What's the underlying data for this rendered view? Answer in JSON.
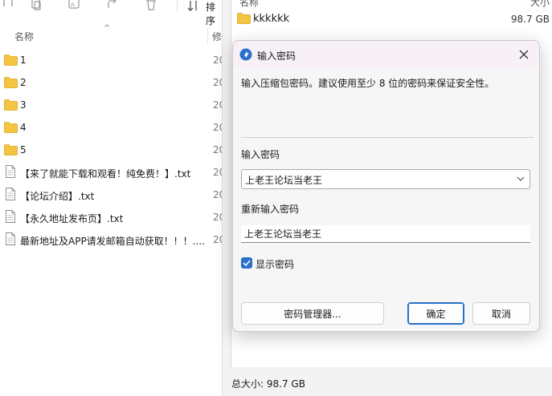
{
  "explorer": {
    "toolbar": {
      "sort_label": "排序"
    },
    "columns": {
      "name": "名称",
      "modified": "修"
    },
    "files": [
      {
        "name": "1",
        "type": "folder",
        "date": "20"
      },
      {
        "name": "2",
        "type": "folder",
        "date": "20"
      },
      {
        "name": "3",
        "type": "folder",
        "date": "20"
      },
      {
        "name": "4",
        "type": "folder",
        "date": "20"
      },
      {
        "name": "5",
        "type": "folder",
        "date": "20"
      },
      {
        "name": "【来了就能下载和观看！纯免费！】.txt",
        "type": "file",
        "date": "20"
      },
      {
        "name": "【论坛介绍】.txt",
        "type": "file",
        "date": "20"
      },
      {
        "name": "【永久地址发布页】.txt",
        "type": "file",
        "date": "20"
      },
      {
        "name": "最新地址及APP请发邮箱自动获取！！！....",
        "type": "file",
        "date": "20"
      }
    ]
  },
  "archive": {
    "header_name": "名称",
    "header_size": "大小",
    "folder_name": "kkkkkk",
    "folder_size": "98.7 GB",
    "status": "总大小: 98.7 GB"
  },
  "dialog": {
    "title": "输入密码",
    "description": "输入压缩包密码。建议使用至少 8 位的密码来保证安全性。",
    "password_label": "输入密码",
    "password_value": "上老王论坛当老王",
    "reenter_label": "重新输入密码",
    "reenter_value": "上老王论坛当老王",
    "show_password_label": "显示密码",
    "show_password_checked": true,
    "manager_button": "密码管理器...",
    "ok_button": "确定",
    "cancel_button": "取消"
  },
  "colors": {
    "accent": "#2a6fc9",
    "folder": "#f4c542",
    "title_bar": "#f7f0f7"
  }
}
